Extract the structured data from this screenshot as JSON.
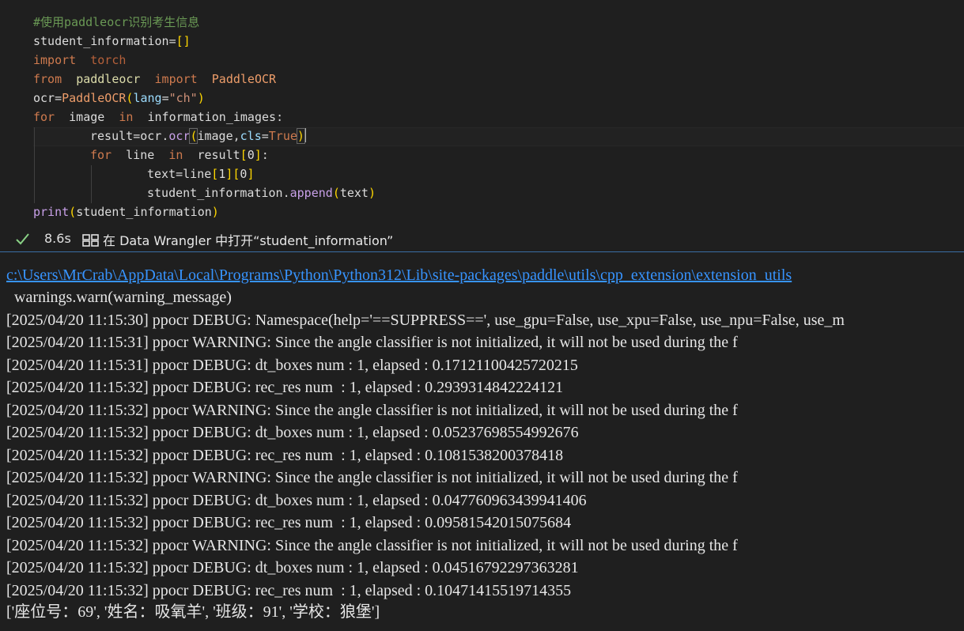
{
  "code": {
    "lines": [
      "#使用paddleocr识别考生信息",
      "student_information=[]",
      "import torch",
      "from paddleocr import PaddleOCR",
      "ocr=PaddleOCR(lang=\"ch\")",
      "for image in information_images:",
      "result=ocr.ocr(image,cls=True)",
      "for line in result[0]:",
      "text=line[1][0]",
      "student_information.append(text)",
      "print(student_information)"
    ],
    "tokens": {
      "comment": "#使用paddleocr识别考生信息",
      "student_information": "student_information",
      "brackets_empty": "[]",
      "import": "import",
      "torch": "torch",
      "from": "from",
      "paddleocr": "paddleocr",
      "PaddleOCR": "PaddleOCR",
      "ocr": "ocr",
      "lang": "lang",
      "ch": "\"ch\"",
      "for": "for",
      "image": "image",
      "in": "in",
      "information_images": "information_images",
      "result": "result",
      "ocr_method": "ocr",
      "cls": "cls",
      "True": "True",
      "line": "line",
      "zero": "0",
      "one": "1",
      "text": "text",
      "append": "append",
      "print": "print"
    }
  },
  "status": {
    "elapsed": "8.6s",
    "wrangler_label": "在 Data Wrangler 中打开“student_information”",
    "check_icon": "check-icon",
    "color_check": "#89d185"
  },
  "output": {
    "link_line": "c:\\Users\\MrCrab\\AppData\\Local\\Programs\\Python\\Python312\\Lib\\site-packages\\paddle\\utils\\cpp_extension\\extension_utils",
    "lines": [
      "  warnings.warn(warning_message)",
      "[2025/04/20 11:15:30] ppocr DEBUG: Namespace(help='==SUPPRESS==', use_gpu=False, use_xpu=False, use_npu=False, use_m",
      "[2025/04/20 11:15:31] ppocr WARNING: Since the angle classifier is not initialized, it will not be used during the f",
      "[2025/04/20 11:15:31] ppocr DEBUG: dt_boxes num : 1, elapsed : 0.17121100425720215",
      "[2025/04/20 11:15:32] ppocr DEBUG: rec_res num  : 1, elapsed : 0.2939314842224121",
      "[2025/04/20 11:15:32] ppocr WARNING: Since the angle classifier is not initialized, it will not be used during the f",
      "[2025/04/20 11:15:32] ppocr DEBUG: dt_boxes num : 1, elapsed : 0.05237698554992676",
      "[2025/04/20 11:15:32] ppocr DEBUG: rec_res num  : 1, elapsed : 0.1081538200378418",
      "[2025/04/20 11:15:32] ppocr WARNING: Since the angle classifier is not initialized, it will not be used during the f",
      "[2025/04/20 11:15:32] ppocr DEBUG: dt_boxes num : 1, elapsed : 0.047760963439941406",
      "[2025/04/20 11:15:32] ppocr DEBUG: rec_res num  : 1, elapsed : 0.09581542015075684",
      "[2025/04/20 11:15:32] ppocr WARNING: Since the angle classifier is not initialized, it will not be used during the f",
      "[2025/04/20 11:15:32] ppocr DEBUG: dt_boxes num : 1, elapsed : 0.04516792297363281",
      "[2025/04/20 11:15:32] ppocr DEBUG: rec_res num  : 1, elapsed : 0.10471415519714355",
      "['座位号：69', '姓名：吸氧羊', '班级：91', '学校：狼堡']"
    ]
  }
}
